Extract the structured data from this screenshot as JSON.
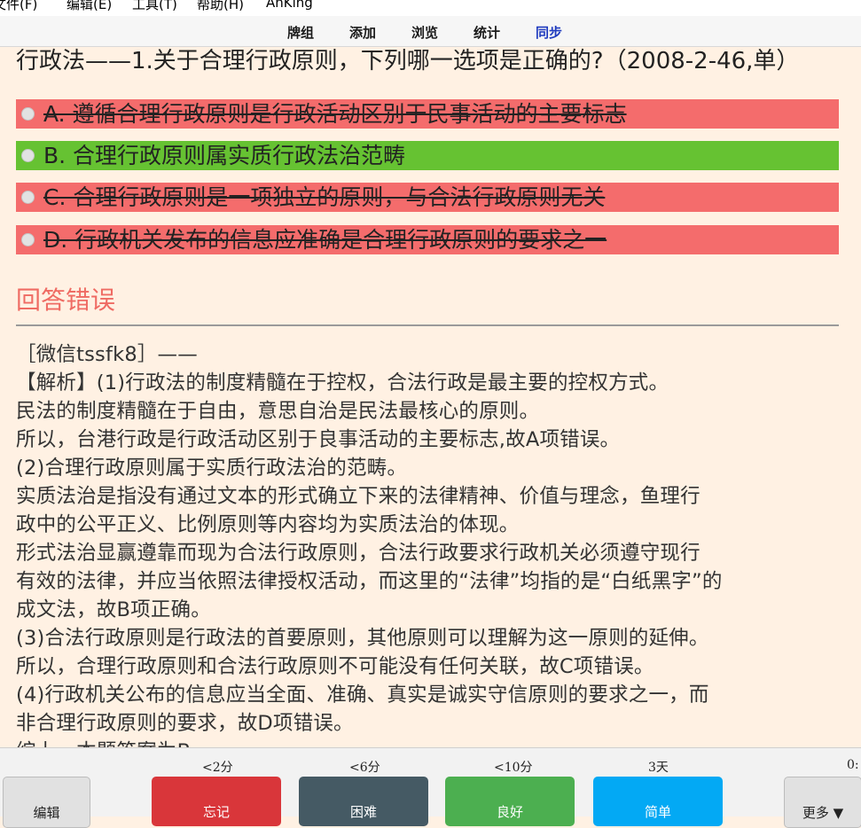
{
  "menubar": {
    "items": [
      "文件(F)",
      "编辑(E)",
      "工具(T)",
      "帮助(H)",
      "AnKing"
    ]
  },
  "toolbar": {
    "decks": "牌组",
    "add": "添加",
    "browse": "浏览",
    "stats": "统计",
    "sync": "同步"
  },
  "card": {
    "question": "行政法——1.关于合理行政原则，下列哪一选项是正确的?（2008-2-46,单）",
    "options": [
      {
        "text": "A. 遵循合理行政原则是行政活动区别于民事活动的主要标志",
        "status": "wrong"
      },
      {
        "text": "B. 合理行政原则属实质行政法治范畴",
        "status": "correct"
      },
      {
        "text": "C. 合理行政原则是一项独立的原则，与合法行政原则无关",
        "status": "wrong"
      },
      {
        "text": "D. 行政机关发布的信息应准确是合理行政原则的要求之一",
        "status": "wrong"
      }
    ],
    "result": "回答错误",
    "explanation": [
      "［微信tssfk8］——",
      "【解析】(1)行政法的制度精髓在于控权，合法行政是最主要的控权方式。",
      "民法的制度精髓在于自由，意思自治是民法最核心的原则。",
      "所以，台港行政是行政活动区别于良事活动的主要标志,故A项错误。",
      "(2)合理行政原则属于实质行政法治的范畴。",
      "实质法治是指没有通过文本的形式确立下来的法律精神、价值与理念，鱼理行",
      "政中的公平正义、比例原则等内容均为实质法治的体现。",
      "形式法治显赢遵靠而现为合法行政原则，合法行政要求行政机关必须遵守现行",
      "有效的法律，并应当依照法律授权活动，而这里的“法律”均指的是“白纸黑字”的",
      "成文法，故B项正确。",
      "(3)合法行政原则是行政法的首要原则，其他原则可以理解为这一原则的延伸。",
      "所以，合理行政原则和合法行政原则不可能没有任何关联，故C项错误。",
      "(4)行政机关公布的信息应当全面、准确、真实是诚实守信原则的要求之一，而",
      "非合理行政原则的要求，故D项错误。",
      "综上，本题答案为B。"
    ]
  },
  "bottombar": {
    "edit": "编辑",
    "again": {
      "label": "忘记",
      "interval": "<2分",
      "color": "#d9363a"
    },
    "hard": {
      "label": "困难",
      "interval": "<6分",
      "color": "#455a64"
    },
    "good": {
      "label": "良好",
      "interval": "<10分",
      "color": "#4caf50"
    },
    "easy": {
      "label": "简单",
      "interval": "3天",
      "color": "#03a9f4"
    },
    "timer": "0:",
    "more": "更多 ▼"
  }
}
